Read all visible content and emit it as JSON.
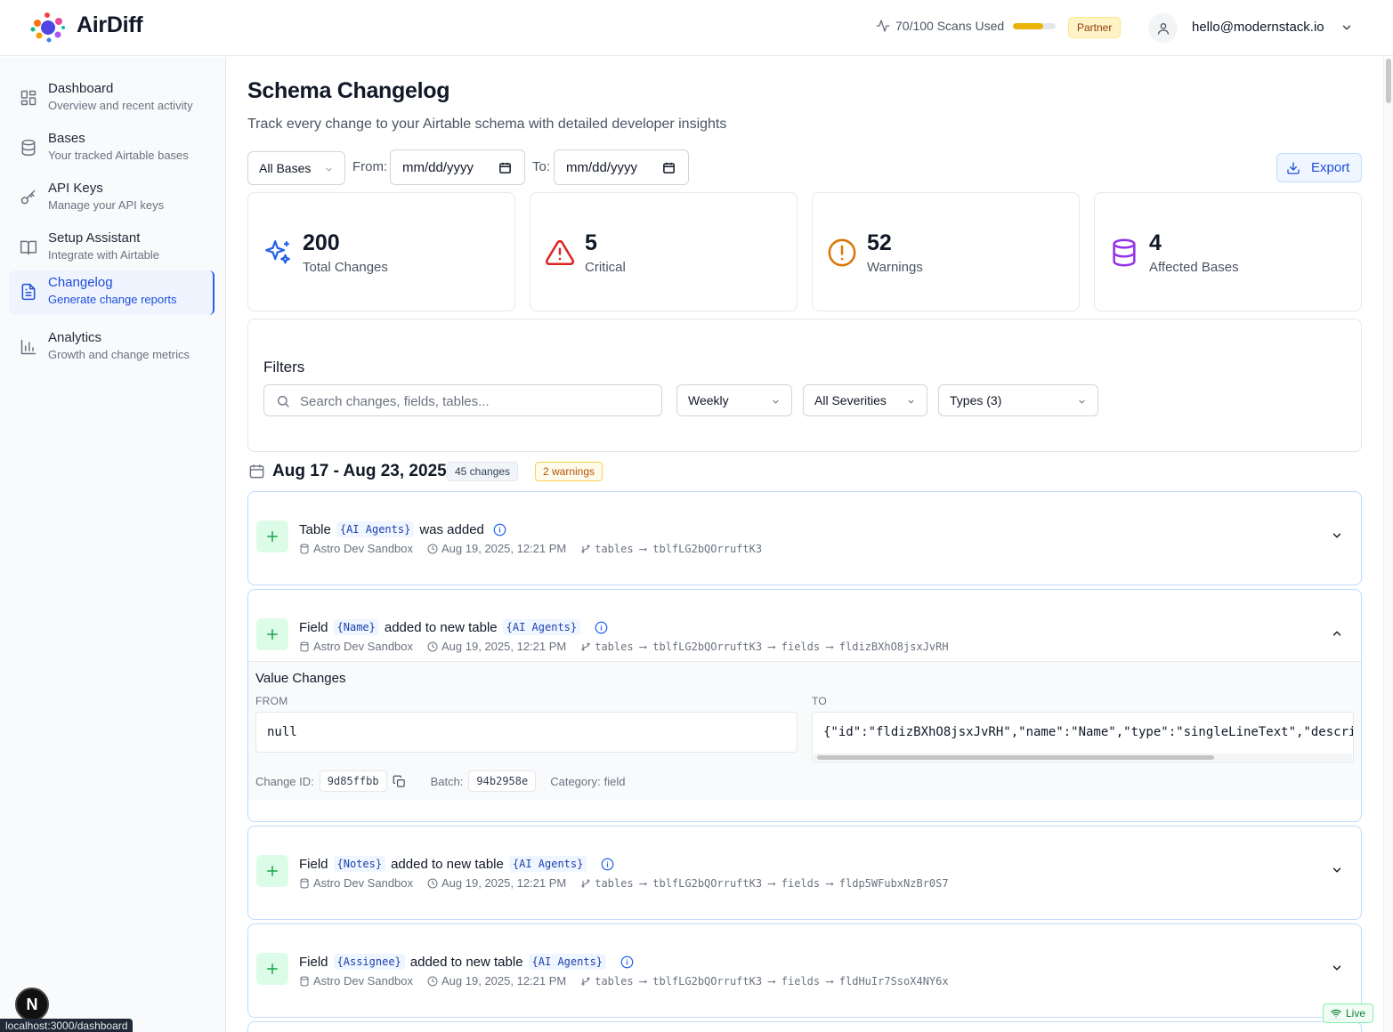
{
  "app": {
    "name": "AirDiff"
  },
  "header": {
    "scans_label": "70/100 Scans Used",
    "scans_used_fraction": 0.7,
    "plan_badge": "Partner",
    "user_email": "hello@modernstack.io"
  },
  "sidebar": {
    "items": [
      {
        "title": "Dashboard",
        "subtitle": "Overview and recent activity",
        "icon": "dashboard-icon"
      },
      {
        "title": "Bases",
        "subtitle": "Your tracked Airtable bases",
        "icon": "database-icon"
      },
      {
        "title": "API Keys",
        "subtitle": "Manage your API keys",
        "icon": "key-icon"
      },
      {
        "title": "Setup Assistant",
        "subtitle": "Integrate with Airtable",
        "icon": "book-icon"
      },
      {
        "title": "Changelog",
        "subtitle": "Generate change reports",
        "icon": "document-icon",
        "active": true
      },
      {
        "title": "Analytics",
        "subtitle": "Growth and change metrics",
        "icon": "bar-chart-icon"
      }
    ]
  },
  "page": {
    "title": "Schema Changelog",
    "subtitle": "Track every change to your Airtable schema with detailed developer insights"
  },
  "toolbar": {
    "base_select": "All Bases",
    "from_label": "From:",
    "from_value": "mm/dd/yyyy",
    "to_label": "To:",
    "to_value": "mm/dd/yyyy",
    "export_label": "Export"
  },
  "stats": [
    {
      "value": "200",
      "label": "Total Changes",
      "icon": "sparkles-icon",
      "color": "#2563eb"
    },
    {
      "value": "5",
      "label": "Critical",
      "icon": "warning-triangle-icon",
      "color": "#dc2626"
    },
    {
      "value": "52",
      "label": "Warnings",
      "icon": "alert-circle-icon",
      "color": "#d97706"
    },
    {
      "value": "4",
      "label": "Affected Bases",
      "icon": "database-icon",
      "color": "#9333ea"
    }
  ],
  "filters": {
    "title": "Filters",
    "search_placeholder": "Search changes, fields, tables...",
    "period": "Weekly",
    "severity": "All Severities",
    "types": "Types (3)"
  },
  "week": {
    "range": "Aug 17 - Aug 23, 2025",
    "changes_badge": "45 changes",
    "warnings_badge": "2 warnings"
  },
  "changes": [
    {
      "kind": "Table",
      "name": "{AI Agents}",
      "action": "was added",
      "base": "Astro Dev Sandbox",
      "time": "Aug 19, 2025, 12:21 PM",
      "path": "tables ⟶ tblfLG2bQOrruftK3"
    },
    {
      "kind": "Field",
      "name": "{Name}",
      "action": "added to new table",
      "table": "{AI Agents}",
      "base": "Astro Dev Sandbox",
      "time": "Aug 19, 2025, 12:21 PM",
      "path": "tables ⟶ tblfLG2bQOrruftK3 ⟶ fields ⟶ fldizBXhO8jsxJvRH",
      "details": {
        "title": "Value Changes",
        "from_label": "FROM",
        "to_label": "TO",
        "from_value": "null",
        "to_value": "{\"id\":\"fldizBXhO8jsxJvRH\",\"name\":\"Name\",\"type\":\"singleLineText\",\"descri",
        "change_id_label": "Change ID:",
        "change_id": "9d85ffbb",
        "batch_label": "Batch:",
        "batch": "94b2958e",
        "category_label": "Category:",
        "category": "field"
      }
    },
    {
      "kind": "Field",
      "name": "{Notes}",
      "action": "added to new table",
      "table": "{AI Agents}",
      "base": "Astro Dev Sandbox",
      "time": "Aug 19, 2025, 12:21 PM",
      "path": "tables ⟶ tblfLG2bQOrruftK3 ⟶ fields ⟶ fldp5WFubxNzBr0S7"
    },
    {
      "kind": "Field",
      "name": "{Assignee}",
      "action": "added to new table",
      "table": "{AI Agents}",
      "base": "Astro Dev Sandbox",
      "time": "Aug 19, 2025, 12:21 PM",
      "path": "tables ⟶ tblfLG2bQOrruftK3 ⟶ fields ⟶ fldHuIr7SsoX4NY6x"
    }
  ],
  "footer": {
    "dev_badge": "N",
    "url": "localhost:3000/dashboard",
    "live_label": "Live"
  }
}
